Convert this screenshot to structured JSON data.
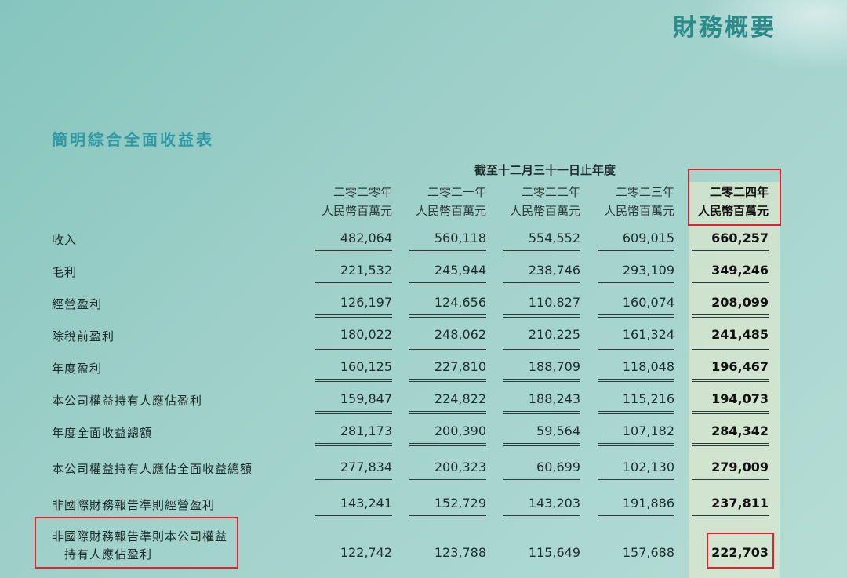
{
  "header": {
    "page_title": "財務概要",
    "section_title": "簡明綜合全面收益表"
  },
  "table": {
    "period_label": "截至十二月三十一日止年度",
    "columns": [
      {
        "year": "二零二零年",
        "unit": "人民幣百萬元"
      },
      {
        "year": "二零二一年",
        "unit": "人民幣百萬元"
      },
      {
        "year": "二零二二年",
        "unit": "人民幣百萬元"
      },
      {
        "year": "二零二三年",
        "unit": "人民幣百萬元"
      },
      {
        "year": "二零二四年",
        "unit": "人民幣百萬元"
      }
    ],
    "rows": [
      {
        "label": "收入",
        "values": [
          "482,064",
          "560,118",
          "554,552",
          "609,015",
          "660,257"
        ]
      },
      {
        "label": "毛利",
        "values": [
          "221,532",
          "245,944",
          "238,746",
          "293,109",
          "349,246"
        ]
      },
      {
        "label": "經營盈利",
        "values": [
          "126,197",
          "124,656",
          "110,827",
          "160,074",
          "208,099"
        ]
      },
      {
        "label": "除稅前盈利",
        "values": [
          "180,022",
          "248,062",
          "210,225",
          "161,324",
          "241,485"
        ]
      },
      {
        "label": "年度盈利",
        "values": [
          "160,125",
          "227,810",
          "188,709",
          "118,048",
          "196,467"
        ]
      },
      {
        "label": "本公司權益持有人應佔盈利",
        "values": [
          "159,847",
          "224,822",
          "188,243",
          "115,216",
          "194,073"
        ]
      },
      {
        "label": "年度全面收益總額",
        "values": [
          "281,173",
          "200,390",
          "59,564",
          "107,182",
          "284,342"
        ]
      },
      {
        "label": "本公司權益持有人應佔全面收益總額",
        "values": [
          "277,834",
          "200,323",
          "60,699",
          "102,130",
          "279,009"
        ]
      },
      {
        "label": "非國際財務報告準則經營盈利",
        "values": [
          "143,241",
          "152,729",
          "143,203",
          "191,886",
          "237,811"
        ]
      },
      {
        "label_line1": "非國際財務報告準則本公司權益",
        "label_line2": "持有人應佔盈利",
        "values": [
          "122,742",
          "123,788",
          "115,649",
          "157,688",
          "222,703"
        ]
      }
    ]
  }
}
